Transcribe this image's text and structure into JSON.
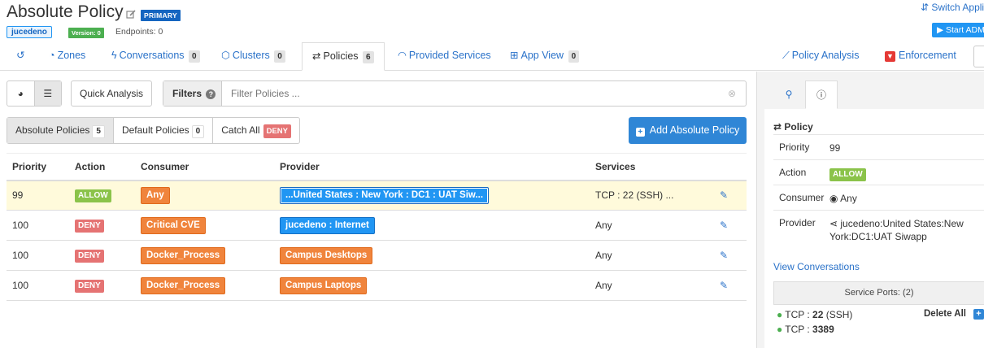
{
  "header": {
    "title": "Absolute Policy",
    "badge_primary": "PRIMARY",
    "scope": "jucedeno",
    "version": "Version: 0",
    "endpoints": "Endpoints: 0",
    "switch_app": "Switch Appli",
    "start_adm": "Start ADM"
  },
  "nav": {
    "tabs": [
      {
        "label": "Zones",
        "icon": "pie-icon"
      },
      {
        "label": "Conversations",
        "count": "0",
        "icon": "bolt-icon"
      },
      {
        "label": "Clusters",
        "count": "0",
        "icon": "cubes-icon"
      },
      {
        "label": "Policies",
        "count": "6",
        "icon": "exchange-icon"
      },
      {
        "label": "Provided Services",
        "icon": "rss-icon"
      },
      {
        "label": "App View",
        "count": "0",
        "icon": "sitemap-icon"
      },
      {
        "label": "Policy Analysis",
        "icon": "line-chart-icon"
      },
      {
        "label": "Enforcement",
        "icon": "shield-icon"
      }
    ]
  },
  "toolbar": {
    "quick_analysis": "Quick Analysis",
    "filters_label": "Filters",
    "filter_placeholder": "Filter Policies ..."
  },
  "subtabs": {
    "absolute": {
      "label": "Absolute Policies",
      "count": "5"
    },
    "default": {
      "label": "Default Policies",
      "count": "0"
    },
    "catch_all": {
      "label": "Catch All",
      "badge": "DENY"
    },
    "add_button": "Add Absolute Policy"
  },
  "table": {
    "headers": [
      "Priority",
      "Action",
      "Consumer",
      "Provider",
      "Services"
    ],
    "rows": [
      {
        "priority": "99",
        "action": "ALLOW",
        "consumer": "Any",
        "provider": "...United States : New York : DC1 : UAT Siw...",
        "services": "TCP : 22 (SSH) ..."
      },
      {
        "priority": "100",
        "action": "DENY",
        "consumer": "Critical CVE",
        "provider": "jucedeno : Internet",
        "services": "Any"
      },
      {
        "priority": "100",
        "action": "DENY",
        "consumer": "Docker_Process",
        "provider": "Campus Desktops",
        "services": "Any"
      },
      {
        "priority": "100",
        "action": "DENY",
        "consumer": "Docker_Process",
        "provider": "Campus Laptops",
        "services": "Any"
      }
    ]
  },
  "detail": {
    "section_title": "Policy",
    "priority_label": "Priority",
    "priority_value": "99",
    "action_label": "Action",
    "action_value": "ALLOW",
    "consumer_label": "Consumer",
    "consumer_value": "Any",
    "provider_label": "Provider",
    "provider_value": "jucedeno:United States:New York:DC1:UAT Siwapp",
    "view_conversations": "View Conversations",
    "service_ports": "Service Ports: (2)",
    "delete_all": "Delete All",
    "ports": [
      {
        "proto": "TCP :",
        "port": "22",
        "name": "(SSH)"
      },
      {
        "proto": "TCP :",
        "port": "3389",
        "name": ""
      }
    ]
  }
}
